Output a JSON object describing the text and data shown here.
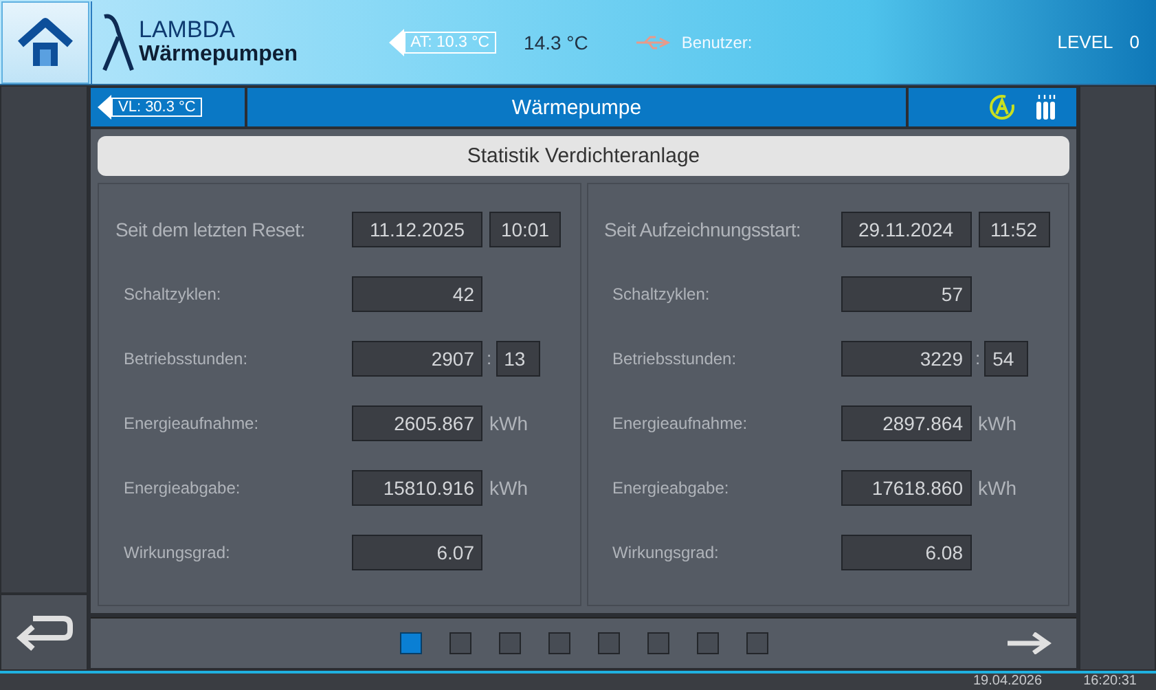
{
  "header": {
    "brand_name": "LAMBDA",
    "brand_sub": "Wärmepumpen",
    "outdoor_temp": "AT: 10.3 °C",
    "room_temp": "14.3 °C",
    "user_label": "Benutzer:",
    "level_label": "LEVEL",
    "level_value": "0"
  },
  "title_bar": {
    "flow_temp": "VL: 30.3 °C",
    "title": "Wärmepumpe"
  },
  "section_title": "Statistik Verdichteranlage",
  "panels": [
    {
      "label": "Seit dem letzten Reset:",
      "date": "11.12.2025",
      "time": "10:01",
      "rows": [
        {
          "label": "Schaltzyklen:",
          "value": "42"
        },
        {
          "label": "Betriebsstunden:",
          "value": "2907",
          "separator": ":",
          "minutes": "13"
        },
        {
          "label": "Energieaufnahme:",
          "value": "2605.867",
          "unit": "kWh"
        },
        {
          "label": "Energieabgabe:",
          "value": "15810.916",
          "unit": "kWh"
        },
        {
          "label": "Wirkungsgrad:",
          "value": "6.07"
        }
      ]
    },
    {
      "label": "Seit Aufzeichnungsstart:",
      "date": "29.11.2024",
      "time": "11:52",
      "rows": [
        {
          "label": "Schaltzyklen:",
          "value": "57"
        },
        {
          "label": "Betriebsstunden:",
          "value": "3229",
          "separator": ":",
          "minutes": "54"
        },
        {
          "label": "Energieaufnahme:",
          "value": "2897.864",
          "unit": "kWh"
        },
        {
          "label": "Energieabgabe:",
          "value": "17618.860",
          "unit": "kWh"
        },
        {
          "label": "Wirkungsgrad:",
          "value": "6.08"
        }
      ]
    }
  ],
  "pages": [
    {
      "selected": true
    },
    {
      "selected": false
    },
    {
      "selected": false
    },
    {
      "selected": false
    },
    {
      "selected": false
    },
    {
      "selected": false
    },
    {
      "selected": false
    },
    {
      "selected": false
    }
  ],
  "status_bar": {
    "date": "19.04.2026",
    "time": "16:20:31"
  }
}
